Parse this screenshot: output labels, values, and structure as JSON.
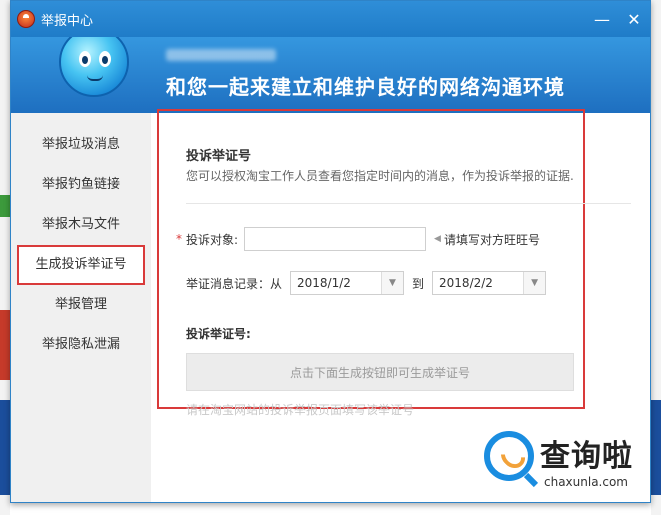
{
  "window": {
    "title": "举报中心",
    "minimize_glyph": "—",
    "close_glyph": "✕"
  },
  "banner": {
    "slogan": "和您一起来建立和维护良好的网络沟通环境"
  },
  "sidebar": {
    "items": [
      {
        "label": "举报垃圾消息"
      },
      {
        "label": "举报钓鱼链接"
      },
      {
        "label": "举报木马文件"
      },
      {
        "label": "生成投诉举证号"
      },
      {
        "label": "举报管理"
      },
      {
        "label": "举报隐私泄漏"
      }
    ],
    "active_index": 3
  },
  "form": {
    "title": "投诉举证号",
    "description": "您可以授权淘宝工作人员查看您指定时间内的消息，作为投诉举报的证据.",
    "target_label": "投诉对象:",
    "target_value": "",
    "target_hint": "请填写对方旺旺号",
    "date_label": "举证消息记录：从",
    "date_from": "2018/1/2",
    "date_to_label": "到",
    "date_to": "2018/2/2",
    "cert_label": "投诉举证号:",
    "generate_button": "点击下面生成按钮即可生成举证号",
    "note": "请在淘宝网站的投诉举报页面填写该举证号"
  },
  "watermark": {
    "cn": "查询啦",
    "en": "chaxunla.com"
  },
  "colors": {
    "titlebar": "#1f7cc8",
    "highlight": "#d93a3a",
    "sidebar_bg": "#f0f0f0"
  }
}
